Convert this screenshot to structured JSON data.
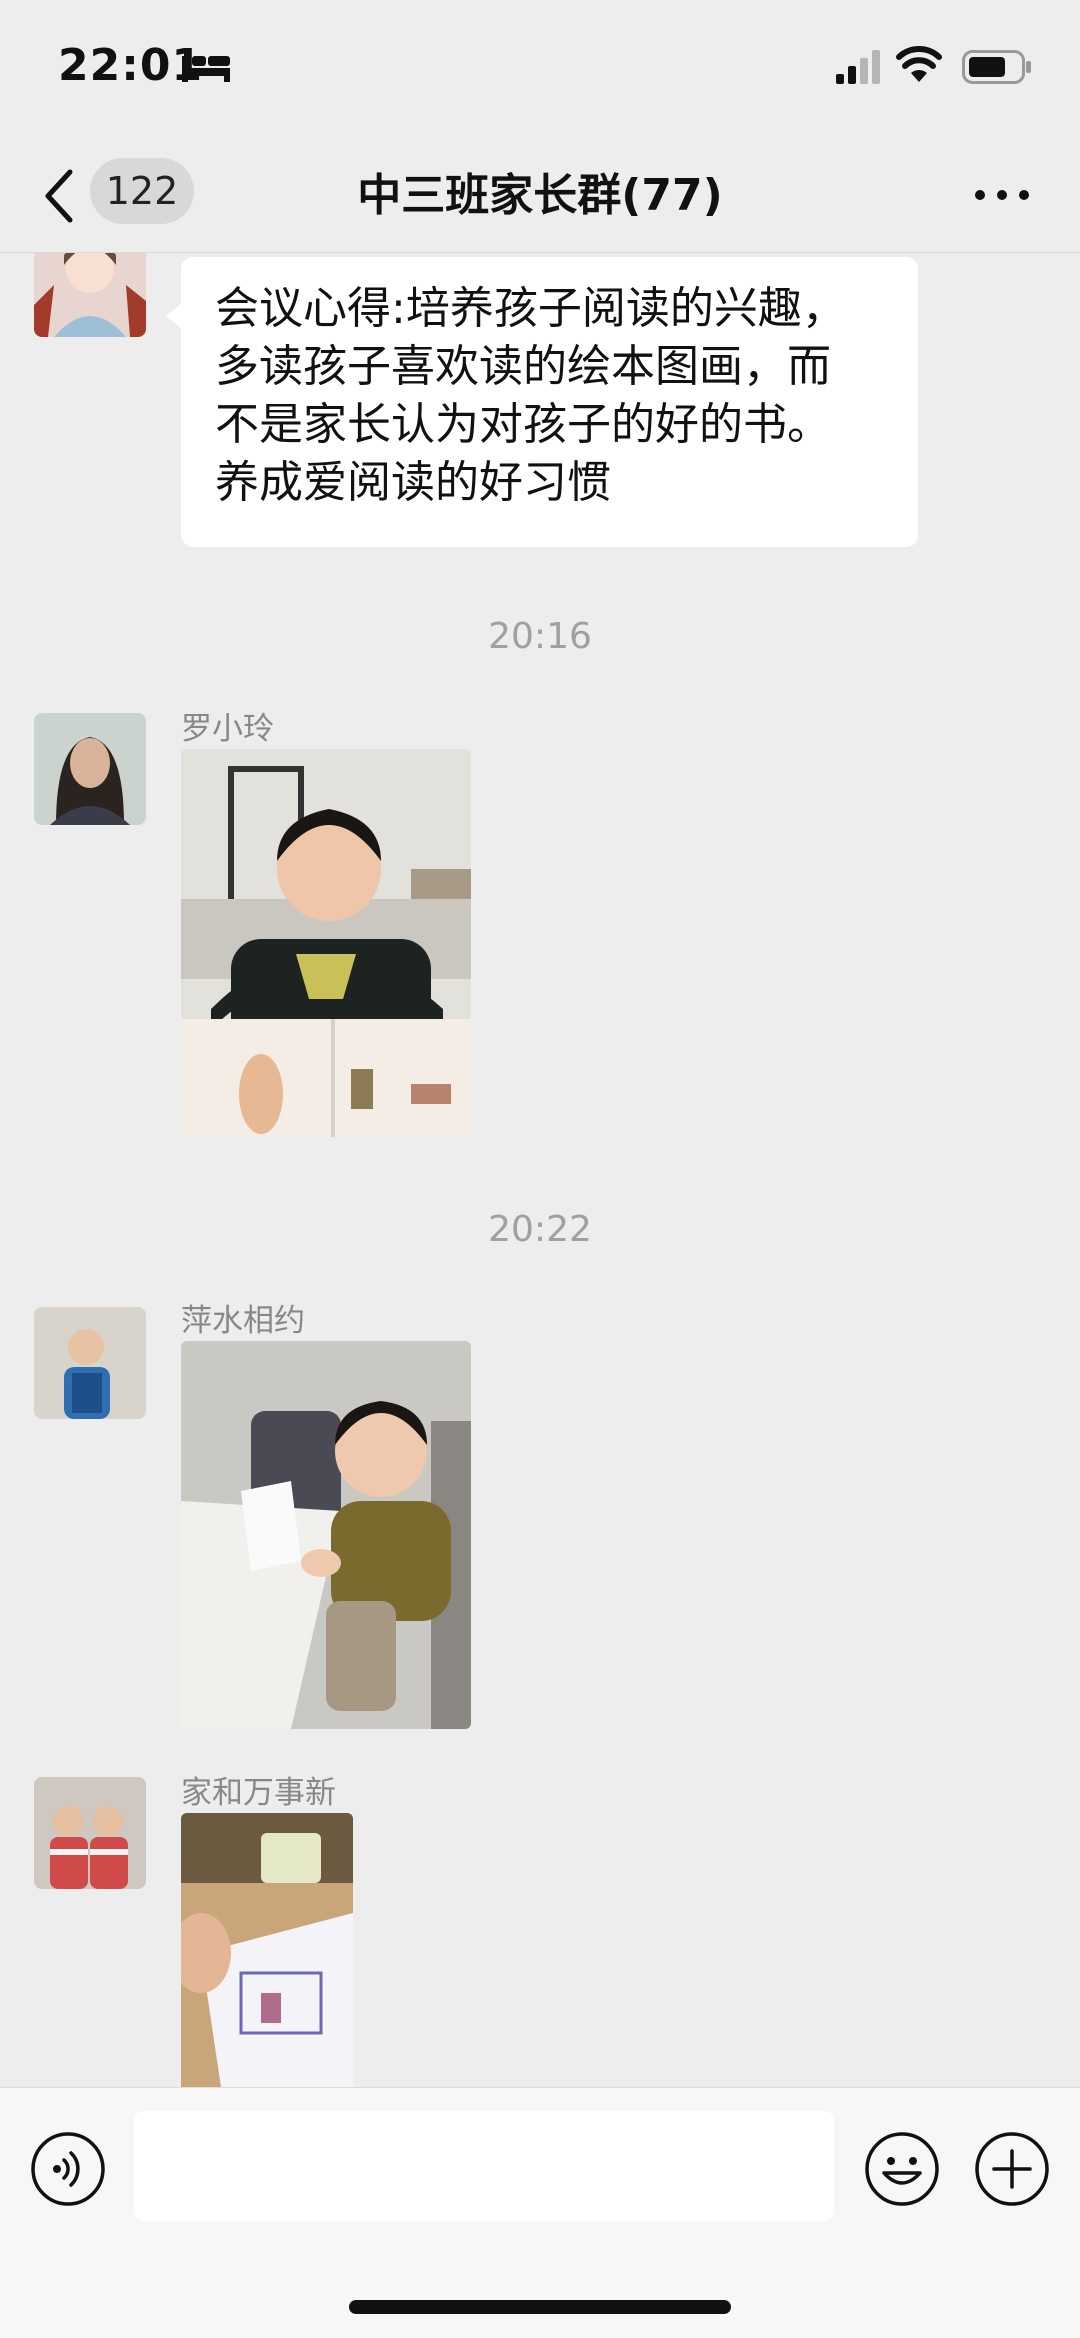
{
  "status_bar": {
    "time": "22:01",
    "icons": [
      "bed-icon",
      "signal-icon",
      "wifi-icon",
      "battery-icon"
    ]
  },
  "nav": {
    "back_count": "122",
    "title": "中三班家长群(77)",
    "icons": [
      "back-chevron-icon",
      "more-icon"
    ]
  },
  "messages": {
    "text_message": {
      "lines": [
        "会议心得:培养孩子阅读的兴趣，",
        "多读孩子喜欢读的绘本图画，而",
        "不是家长认为对孩子的好的书。",
        "养成爱阅读的好习惯"
      ]
    },
    "timestamp_1": "20:16",
    "msg1_sender": "罗小玲",
    "timestamp_2": "20:22",
    "msg2_sender": "萍水相约",
    "msg3_sender": "家和万事新"
  },
  "input_bar": {
    "placeholder": "",
    "icons": [
      "voice-icon",
      "emoji-icon",
      "plus-icon"
    ]
  },
  "colors": {
    "background": "#ededed",
    "bubble": "#ffffff",
    "input_bar": "#f7f7f7",
    "text": "#111111",
    "muted": "#a0a0a0"
  }
}
